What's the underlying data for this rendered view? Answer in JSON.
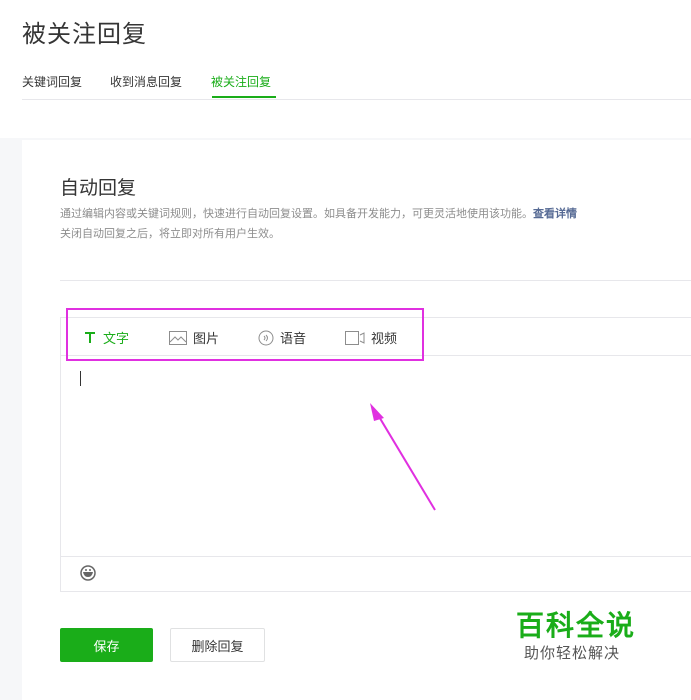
{
  "header": {
    "title": "被关注回复",
    "tabs": [
      {
        "label": "关键词回复",
        "active": false
      },
      {
        "label": "收到消息回复",
        "active": false
      },
      {
        "label": "被关注回复",
        "active": true
      }
    ]
  },
  "main": {
    "section_title": "自动回复",
    "description_line1": "通过编辑内容或关键词规则，快速进行自动回复设置。如具备开发能力，可更灵活地使用该功能。",
    "description_link": "查看详情",
    "description_line2": "关闭自动回复之后，将立即对所有用户生效。",
    "editor": {
      "types": [
        {
          "label": "文字",
          "icon": "text-icon",
          "active": true
        },
        {
          "label": "图片",
          "icon": "image-icon",
          "active": false
        },
        {
          "label": "语音",
          "icon": "voice-icon",
          "active": false
        },
        {
          "label": "视频",
          "icon": "video-icon",
          "active": false
        }
      ],
      "content": "",
      "emoji_icon": "emoji-icon"
    },
    "buttons": {
      "save": "保存",
      "delete": "删除回复"
    }
  },
  "watermark": {
    "main": "百科全说",
    "sub": "助你轻松解决"
  },
  "colors": {
    "accent": "#1aad19",
    "highlight": "#e030e0",
    "link": "#576b95"
  }
}
